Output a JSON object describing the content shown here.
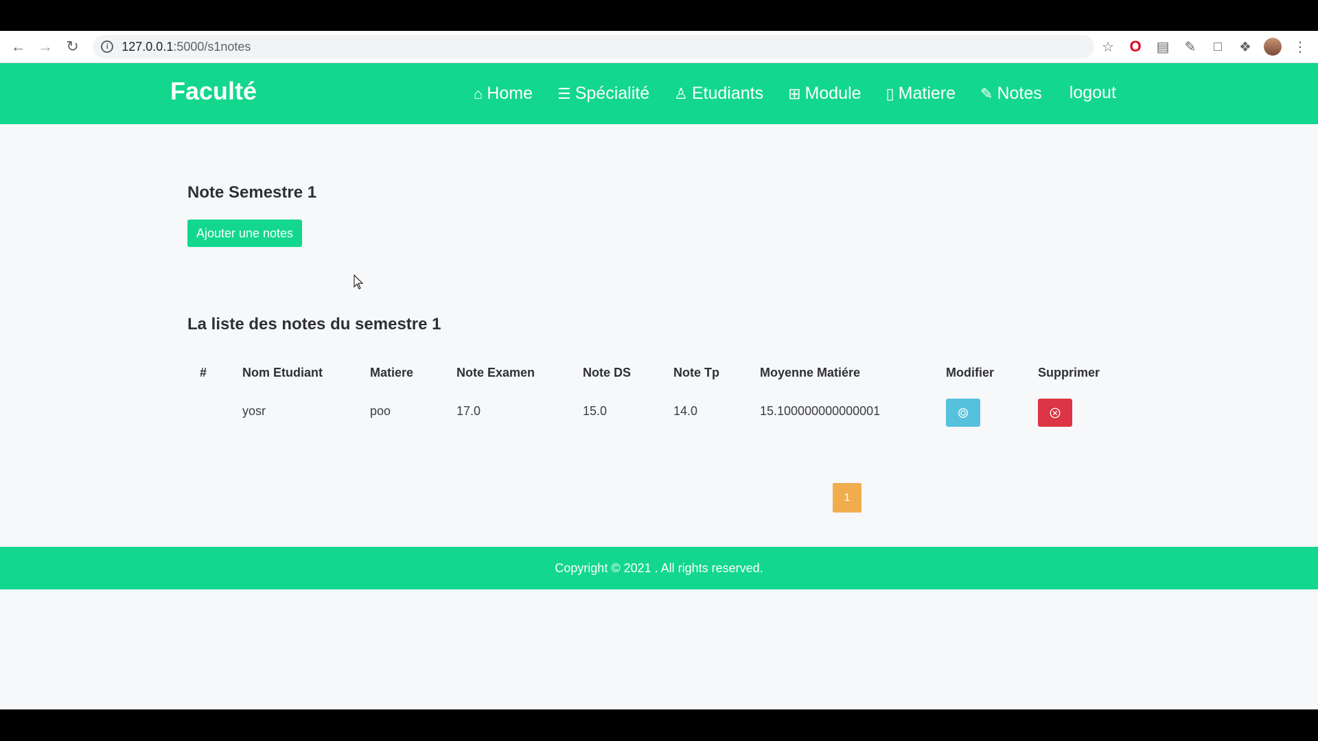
{
  "browser": {
    "url_host": "127.0.0.1",
    "url_path": ":5000/s1notes"
  },
  "header": {
    "brand": "Faculté",
    "menu": [
      {
        "label": "Home",
        "icon": "home-icon"
      },
      {
        "label": "Spécialité",
        "icon": "list-icon"
      },
      {
        "label": "Etudiants",
        "icon": "student-icon"
      },
      {
        "label": "Module",
        "icon": "grid-icon"
      },
      {
        "label": "Matiere",
        "icon": "book-icon"
      },
      {
        "label": "Notes",
        "icon": "edit-icon"
      },
      {
        "label": "logout",
        "icon": ""
      }
    ]
  },
  "main": {
    "title": "Note Semestre 1",
    "add_button": "Ajouter une notes",
    "list_title": "La liste des notes du semestre 1",
    "table": {
      "headers": [
        "#",
        "Nom Etudiant",
        "Matiere",
        "Note Examen",
        "Note DS",
        "Note Tp",
        "Moyenne Matiére",
        "Modifier",
        "Supprimer"
      ],
      "rows": [
        {
          "num": "",
          "nom": "yosr",
          "matiere": "poo",
          "examen": "17.0",
          "ds": "15.0",
          "tp": "14.0",
          "moyenne": "15.100000000000001"
        }
      ]
    },
    "pagination": {
      "current": "1"
    }
  },
  "footer": {
    "copyright": "Copyright © 2021 . All rights reserved."
  },
  "colors": {
    "brand_green": "#12d78d",
    "edit_blue": "#55c1dc",
    "delete_red": "#dc3545",
    "pager_orange": "#f0ad4e"
  }
}
